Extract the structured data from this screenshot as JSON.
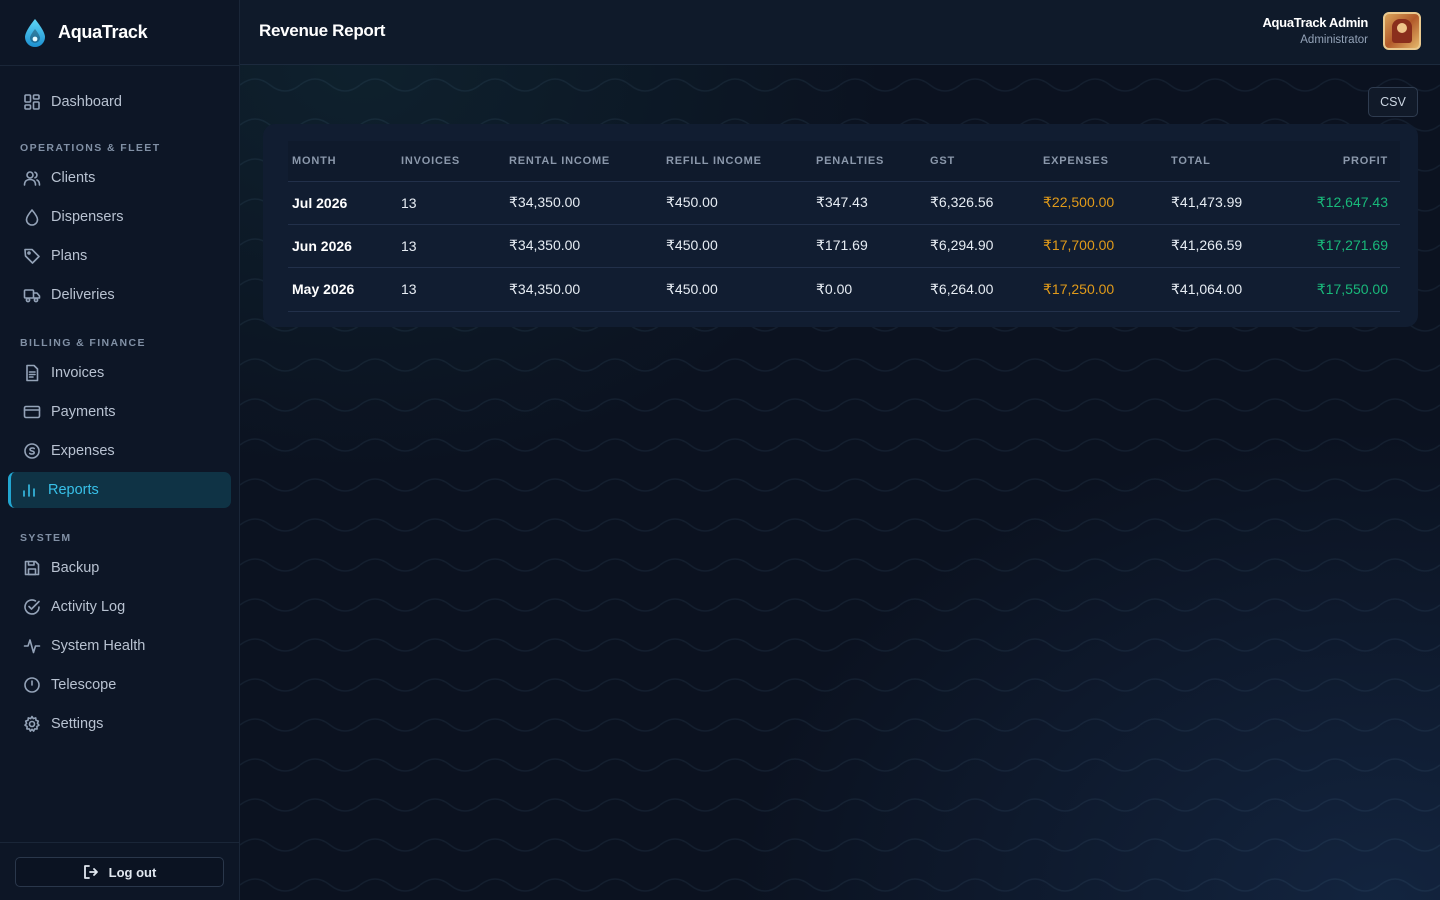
{
  "app": {
    "name": "AquaTrack",
    "colors": {
      "accent": "#38c0e8",
      "expense": "#e09a1a",
      "profit": "#19b87a",
      "background": "#0b1220"
    }
  },
  "sidebar": {
    "top_item": {
      "label": "Dashboard",
      "icon": "grid-icon"
    },
    "sections": [
      {
        "label": "OPERATIONS & FLEET",
        "items": [
          {
            "label": "Clients",
            "icon": "users-icon"
          },
          {
            "label": "Dispensers",
            "icon": "droplet-icon"
          },
          {
            "label": "Plans",
            "icon": "tag-icon"
          },
          {
            "label": "Deliveries",
            "icon": "truck-icon"
          }
        ]
      },
      {
        "label": "BILLING & FINANCE",
        "items": [
          {
            "label": "Invoices",
            "icon": "file-icon"
          },
          {
            "label": "Payments",
            "icon": "card-icon"
          },
          {
            "label": "Expenses",
            "icon": "coin-icon"
          },
          {
            "label": "Reports",
            "icon": "bar-chart-icon",
            "active": true
          }
        ]
      },
      {
        "label": "SYSTEM",
        "items": [
          {
            "label": "Backup",
            "icon": "save-icon"
          },
          {
            "label": "Activity Log",
            "icon": "check-circle-icon"
          },
          {
            "label": "System Health",
            "icon": "pulse-icon"
          },
          {
            "label": "Telescope",
            "icon": "clock-icon"
          },
          {
            "label": "Settings",
            "icon": "gear-icon"
          }
        ]
      }
    ],
    "logout_label": "Log out"
  },
  "header": {
    "title": "Revenue Report",
    "user_name": "AquaTrack Admin",
    "user_role": "Administrator"
  },
  "toolbar": {
    "csv_label": "CSV"
  },
  "table": {
    "columns": [
      "MONTH",
      "INVOICES",
      "RENTAL INCOME",
      "REFILL INCOME",
      "PENALTIES",
      "GST",
      "EXPENSES",
      "TOTAL",
      "PROFIT"
    ],
    "rows": [
      [
        "Jul 2026",
        "13",
        "₹34,350.00",
        "₹450.00",
        "₹347.43",
        "₹6,326.56",
        "₹22,500.00",
        "₹41,473.99",
        "₹12,647.43"
      ],
      [
        "Jun 2026",
        "13",
        "₹34,350.00",
        "₹450.00",
        "₹171.69",
        "₹6,294.90",
        "₹17,700.00",
        "₹41,266.59",
        "₹17,271.69"
      ],
      [
        "May 2026",
        "13",
        "₹34,350.00",
        "₹450.00",
        "₹0.00",
        "₹6,264.00",
        "₹17,250.00",
        "₹41,064.00",
        "₹17,550.00"
      ]
    ]
  }
}
